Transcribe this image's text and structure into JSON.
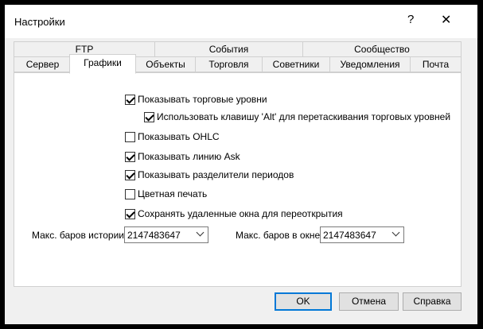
{
  "window": {
    "title": "Настройки",
    "help_glyph": "?",
    "close_glyph": "✕"
  },
  "tabs_row1": [
    {
      "label": "FTP"
    },
    {
      "label": "События"
    },
    {
      "label": "Сообщество"
    }
  ],
  "tabs_row2": [
    {
      "label": "Сервер"
    },
    {
      "label": "Графики",
      "active": true
    },
    {
      "label": "Объекты"
    },
    {
      "label": "Торговля"
    },
    {
      "label": "Советники"
    },
    {
      "label": "Уведомления"
    },
    {
      "label": "Почта"
    }
  ],
  "options": [
    {
      "label": "Показывать торговые уровни",
      "checked": true
    },
    {
      "label": "Использовать клавишу 'Alt' для перетаскивания торговых уровней",
      "checked": true
    },
    {
      "label": "Показывать OHLC",
      "checked": false
    },
    {
      "label": "Показывать линию Ask",
      "checked": true
    },
    {
      "label": "Показывать разделители периодов",
      "checked": true
    },
    {
      "label": "Цветная печать",
      "checked": false
    },
    {
      "label": "Сохранять удаленные окна для переоткрытия",
      "checked": true
    }
  ],
  "max_bars_history": {
    "label": "Макс. баров истории:",
    "value": "2147483647"
  },
  "max_bars_window": {
    "label": "Макс. баров в окне:",
    "value": "2147483647"
  },
  "buttons": {
    "ok": "OK",
    "cancel": "Отмена",
    "help": "Справка"
  },
  "colors": {
    "accent": "#0078d7",
    "window_bg": "#f0f0f0",
    "titlebar": "#ffffff"
  }
}
